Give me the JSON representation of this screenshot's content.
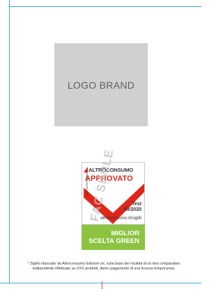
{
  "logo": {
    "text": "LOGO BRAND"
  },
  "seal": {
    "brand": "ALTROCONSUMO",
    "status": "APPROVATO",
    "test_label": "Test",
    "test_date": "03/2020",
    "url": "altroconsumo.it/sigilli",
    "side_text": "ALTROCONSUMO",
    "watermark": "FAC SIMILE",
    "award_line1": "MIGLIOR",
    "award_line2": "SCELTA GREEN",
    "colors": {
      "red": "#e0261a",
      "green": "#8cc341"
    }
  },
  "footnote": "* Sigillo rilasciato da Altroconsumo Edizioni srl, sulla base dei risultati di un test comparativo indipendente effettuato su XXX prodotti, dietro pagamento di una licenza temporanea."
}
